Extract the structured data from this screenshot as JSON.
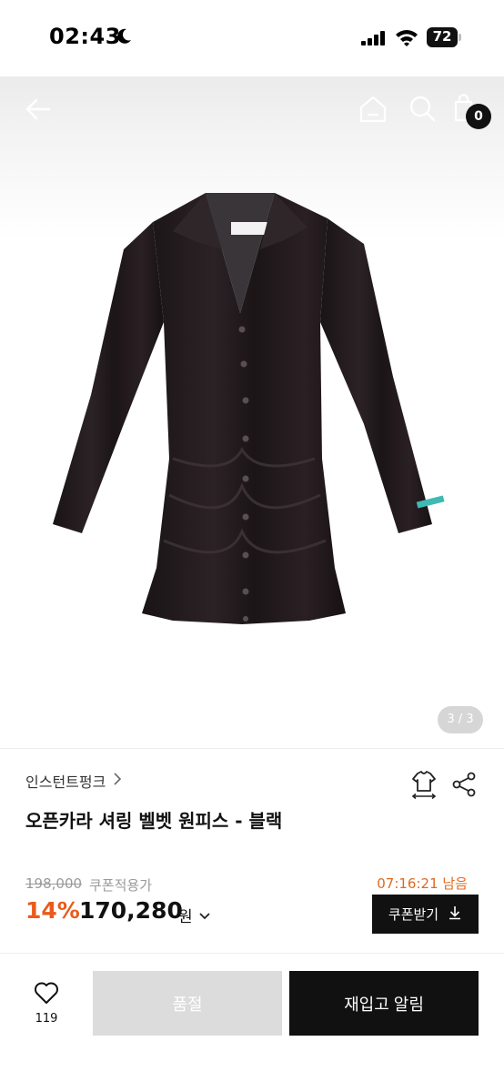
{
  "status_bar": {
    "time": "02:43",
    "battery": "72",
    "icons": [
      "moon-icon",
      "signal-icon",
      "wifi-icon",
      "battery-icon"
    ]
  },
  "nav": {
    "cart_count": "0",
    "icons": [
      "back-arrow-icon",
      "home-icon",
      "search-icon",
      "cart-icon"
    ]
  },
  "gallery": {
    "counter": "3 / 3"
  },
  "product": {
    "brand": "인스턴트펑크",
    "title": "오픈카라 셔링 벨벳 원피스 - 블랙",
    "original_price": "198,000",
    "coupon_note": "쿠폰적용가",
    "timer": "07:16:21 남음",
    "discount": "14%",
    "price": "170,280",
    "price_unit": "원",
    "coupon_button": "쿠폰받기"
  },
  "bottom_bar": {
    "like_count": "119",
    "soldout_label": "품절",
    "restock_label": "재입고 알림"
  },
  "colors": {
    "accent_orange": "#ea5a1b",
    "dark": "#111111",
    "soldout_gray": "#dcdcdc"
  }
}
